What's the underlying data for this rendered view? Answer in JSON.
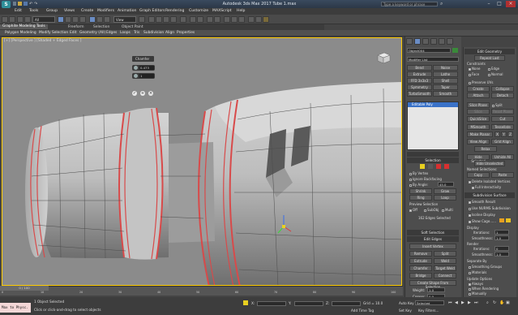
{
  "window": {
    "title": "Autodesk 3ds Max 2017      Tube 1.max",
    "search_placeholder": "Type a keyword or phrase",
    "logo_text": "S"
  },
  "menu": [
    "Edit",
    "Tools",
    "Group",
    "Views",
    "Create",
    "Modifiers",
    "Animation",
    "Graph Editors",
    "Rendering",
    "Customize",
    "MAXScript",
    "Help"
  ],
  "toolbar": {
    "selection_filter": "All",
    "reference_coord": "View"
  },
  "ribbon": {
    "tabs": [
      {
        "label": "Graphite Modeling Tools",
        "active": true
      },
      {
        "label": "Freeform",
        "active": false
      },
      {
        "label": "Selection",
        "active": false
      },
      {
        "label": "Object Paint",
        "active": false
      }
    ],
    "sub_items": [
      "Polygon Modeling",
      "Modify Selection",
      "Edit",
      "Geometry (All)",
      "Edges",
      "Loops",
      "Tris",
      "Subdivision",
      "Align",
      "Properties"
    ]
  },
  "viewport": {
    "label": "[+] [Perspective ] [Shaded + Edged Faces ]",
    "background": "#8b8b8b"
  },
  "caddy": {
    "title": "Chamfer",
    "amount": "0.473",
    "segments": "1"
  },
  "command_panel": {
    "object_name": "Object004",
    "modifier_list": "Modifier List",
    "modifier_buttons": [
      "Bend",
      "Noise",
      "Extrude",
      "Lathe",
      "FFD 3x3x3",
      "Shell",
      "Symmetry",
      "Taper",
      "TurboSmooth",
      "Smooth"
    ],
    "stack_item": "Editable Poly",
    "selection_header": "Selection",
    "by_vertex": "By Vertex",
    "ignore_backfacing": "Ignore Backfacing",
    "by_angle": "By Angle:",
    "by_angle_value": "45.0",
    "shrink": "Shrink",
    "grow": "Grow",
    "ring": "Ring",
    "loop": "Loop",
    "preview_selection": "Preview Selection",
    "off": "Off",
    "subobj": "SubObj",
    "multi": "Multi",
    "selected_count": "162 Edges Selected",
    "soft_selection": "Soft Selection",
    "edit_edges": "Edit Edges",
    "insert_vertex": "Insert Vertex",
    "remove": "Remove",
    "split": "Split",
    "extrude": "Extrude",
    "weld": "Weld",
    "chamfer": "Chamfer",
    "target_weld": "Target Weld",
    "bridge": "Bridge",
    "connect": "Connect",
    "create_shape": "Create Shape From Selection",
    "weight": "Weight:",
    "weight_value": "1.0",
    "crease": "Crease:",
    "crease_value": "0.0"
  },
  "right_panel": {
    "edit_geometry": "Edit Geometry",
    "repeat_last": "Repeat Last",
    "constraints": "Constraints",
    "c_none": "None",
    "c_edge": "Edge",
    "c_face": "Face",
    "c_normal": "Normal",
    "preserve_uvs": "Preserve UVs",
    "create": "Create",
    "collapse": "Collapse",
    "attach": "Attach",
    "detach": "Detach",
    "slice_plane": "Slice Plane",
    "split": "Split",
    "slice": "Slice",
    "reset_plane": "Reset Plane",
    "quickslice": "QuickSlice",
    "cut": "Cut",
    "msmooth": "MSmooth",
    "tessellate": "Tessellate",
    "make_planar": "Make Planar",
    "x": "X",
    "y": "Y",
    "z": "Z",
    "view_align": "View Align",
    "grid_align": "Grid Align",
    "relax": "Relax",
    "hide_selected": "Hide Selected",
    "unhide_all": "Unhide All",
    "hide_unselected": "Hide Unselected",
    "named_selections": "Named Selections:",
    "copy": "Copy",
    "paste": "Paste",
    "delete_isolated": "Delete Isolated Vertices",
    "full_interactivity": "Full Interactivity",
    "subdivision_surface": "Subdivision Surface",
    "smooth_result": "Smooth Result",
    "use_nurms": "Use NURMS Subdivision",
    "isoline_display": "Isoline Display",
    "show_cage": "Show Cage......",
    "display": "Display",
    "iterations": "Iterations:",
    "iterations_value": "1",
    "smoothness": "Smoothness:",
    "smoothness_value": "1.0",
    "render": "Render",
    "r_iterations_value": "0",
    "r_smoothness_value": "1.0",
    "separate_by": "Separate By",
    "smoothing_groups": "Smoothing Groups",
    "materials": "Materials",
    "update_options": "Update Options",
    "always": "Always",
    "when_rendering": "When Rendering",
    "manually": "Manually",
    "cage_color_1": "#e8a020",
    "cage_color_2": "#e8c020"
  },
  "timeline": {
    "slider": "0 / 100",
    "ticks": [
      "0",
      "10",
      "20",
      "30",
      "40",
      "50",
      "60",
      "70",
      "80",
      "90",
      "100"
    ]
  },
  "status": {
    "maxscript": "Max to Physc.",
    "selected": "1 Object Selected",
    "hint": "Click or click-and-drag to select objects",
    "x_label": "X:",
    "x_value": "",
    "y_label": "Y:",
    "y_value": "",
    "z_label": "Z:",
    "z_value": "",
    "grid": "Grid = 10.0",
    "add_time_tag": "Add Time Tag",
    "auto_key": "Auto Key",
    "selected_dd": "Selected",
    "set_key": "Set Key",
    "key_filters": "Key Filters..."
  }
}
